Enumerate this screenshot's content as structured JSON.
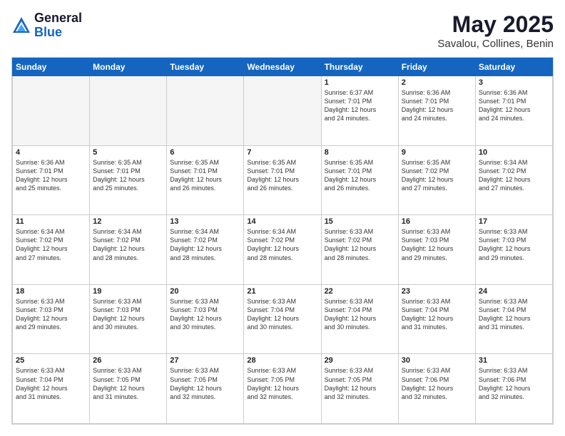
{
  "logo": {
    "general": "General",
    "blue": "Blue"
  },
  "title": "May 2025",
  "location": "Savalou, Collines, Benin",
  "days_of_week": [
    "Sunday",
    "Monday",
    "Tuesday",
    "Wednesday",
    "Thursday",
    "Friday",
    "Saturday"
  ],
  "weeks": [
    [
      {
        "day": "",
        "info": ""
      },
      {
        "day": "",
        "info": ""
      },
      {
        "day": "",
        "info": ""
      },
      {
        "day": "",
        "info": ""
      },
      {
        "day": "1",
        "info": "Sunrise: 6:37 AM\nSunset: 7:01 PM\nDaylight: 12 hours\nand 24 minutes."
      },
      {
        "day": "2",
        "info": "Sunrise: 6:36 AM\nSunset: 7:01 PM\nDaylight: 12 hours\nand 24 minutes."
      },
      {
        "day": "3",
        "info": "Sunrise: 6:36 AM\nSunset: 7:01 PM\nDaylight: 12 hours\nand 24 minutes."
      }
    ],
    [
      {
        "day": "4",
        "info": "Sunrise: 6:36 AM\nSunset: 7:01 PM\nDaylight: 12 hours\nand 25 minutes."
      },
      {
        "day": "5",
        "info": "Sunrise: 6:35 AM\nSunset: 7:01 PM\nDaylight: 12 hours\nand 25 minutes."
      },
      {
        "day": "6",
        "info": "Sunrise: 6:35 AM\nSunset: 7:01 PM\nDaylight: 12 hours\nand 26 minutes."
      },
      {
        "day": "7",
        "info": "Sunrise: 6:35 AM\nSunset: 7:01 PM\nDaylight: 12 hours\nand 26 minutes."
      },
      {
        "day": "8",
        "info": "Sunrise: 6:35 AM\nSunset: 7:01 PM\nDaylight: 12 hours\nand 26 minutes."
      },
      {
        "day": "9",
        "info": "Sunrise: 6:35 AM\nSunset: 7:02 PM\nDaylight: 12 hours\nand 27 minutes."
      },
      {
        "day": "10",
        "info": "Sunrise: 6:34 AM\nSunset: 7:02 PM\nDaylight: 12 hours\nand 27 minutes."
      }
    ],
    [
      {
        "day": "11",
        "info": "Sunrise: 6:34 AM\nSunset: 7:02 PM\nDaylight: 12 hours\nand 27 minutes."
      },
      {
        "day": "12",
        "info": "Sunrise: 6:34 AM\nSunset: 7:02 PM\nDaylight: 12 hours\nand 28 minutes."
      },
      {
        "day": "13",
        "info": "Sunrise: 6:34 AM\nSunset: 7:02 PM\nDaylight: 12 hours\nand 28 minutes."
      },
      {
        "day": "14",
        "info": "Sunrise: 6:34 AM\nSunset: 7:02 PM\nDaylight: 12 hours\nand 28 minutes."
      },
      {
        "day": "15",
        "info": "Sunrise: 6:33 AM\nSunset: 7:02 PM\nDaylight: 12 hours\nand 28 minutes."
      },
      {
        "day": "16",
        "info": "Sunrise: 6:33 AM\nSunset: 7:03 PM\nDaylight: 12 hours\nand 29 minutes."
      },
      {
        "day": "17",
        "info": "Sunrise: 6:33 AM\nSunset: 7:03 PM\nDaylight: 12 hours\nand 29 minutes."
      }
    ],
    [
      {
        "day": "18",
        "info": "Sunrise: 6:33 AM\nSunset: 7:03 PM\nDaylight: 12 hours\nand 29 minutes."
      },
      {
        "day": "19",
        "info": "Sunrise: 6:33 AM\nSunset: 7:03 PM\nDaylight: 12 hours\nand 30 minutes."
      },
      {
        "day": "20",
        "info": "Sunrise: 6:33 AM\nSunset: 7:03 PM\nDaylight: 12 hours\nand 30 minutes."
      },
      {
        "day": "21",
        "info": "Sunrise: 6:33 AM\nSunset: 7:04 PM\nDaylight: 12 hours\nand 30 minutes."
      },
      {
        "day": "22",
        "info": "Sunrise: 6:33 AM\nSunset: 7:04 PM\nDaylight: 12 hours\nand 30 minutes."
      },
      {
        "day": "23",
        "info": "Sunrise: 6:33 AM\nSunset: 7:04 PM\nDaylight: 12 hours\nand 31 minutes."
      },
      {
        "day": "24",
        "info": "Sunrise: 6:33 AM\nSunset: 7:04 PM\nDaylight: 12 hours\nand 31 minutes."
      }
    ],
    [
      {
        "day": "25",
        "info": "Sunrise: 6:33 AM\nSunset: 7:04 PM\nDaylight: 12 hours\nand 31 minutes."
      },
      {
        "day": "26",
        "info": "Sunrise: 6:33 AM\nSunset: 7:05 PM\nDaylight: 12 hours\nand 31 minutes."
      },
      {
        "day": "27",
        "info": "Sunrise: 6:33 AM\nSunset: 7:05 PM\nDaylight: 12 hours\nand 32 minutes."
      },
      {
        "day": "28",
        "info": "Sunrise: 6:33 AM\nSunset: 7:05 PM\nDaylight: 12 hours\nand 32 minutes."
      },
      {
        "day": "29",
        "info": "Sunrise: 6:33 AM\nSunset: 7:05 PM\nDaylight: 12 hours\nand 32 minutes."
      },
      {
        "day": "30",
        "info": "Sunrise: 6:33 AM\nSunset: 7:06 PM\nDaylight: 12 hours\nand 32 minutes."
      },
      {
        "day": "31",
        "info": "Sunrise: 6:33 AM\nSunset: 7:06 PM\nDaylight: 12 hours\nand 32 minutes."
      }
    ]
  ]
}
